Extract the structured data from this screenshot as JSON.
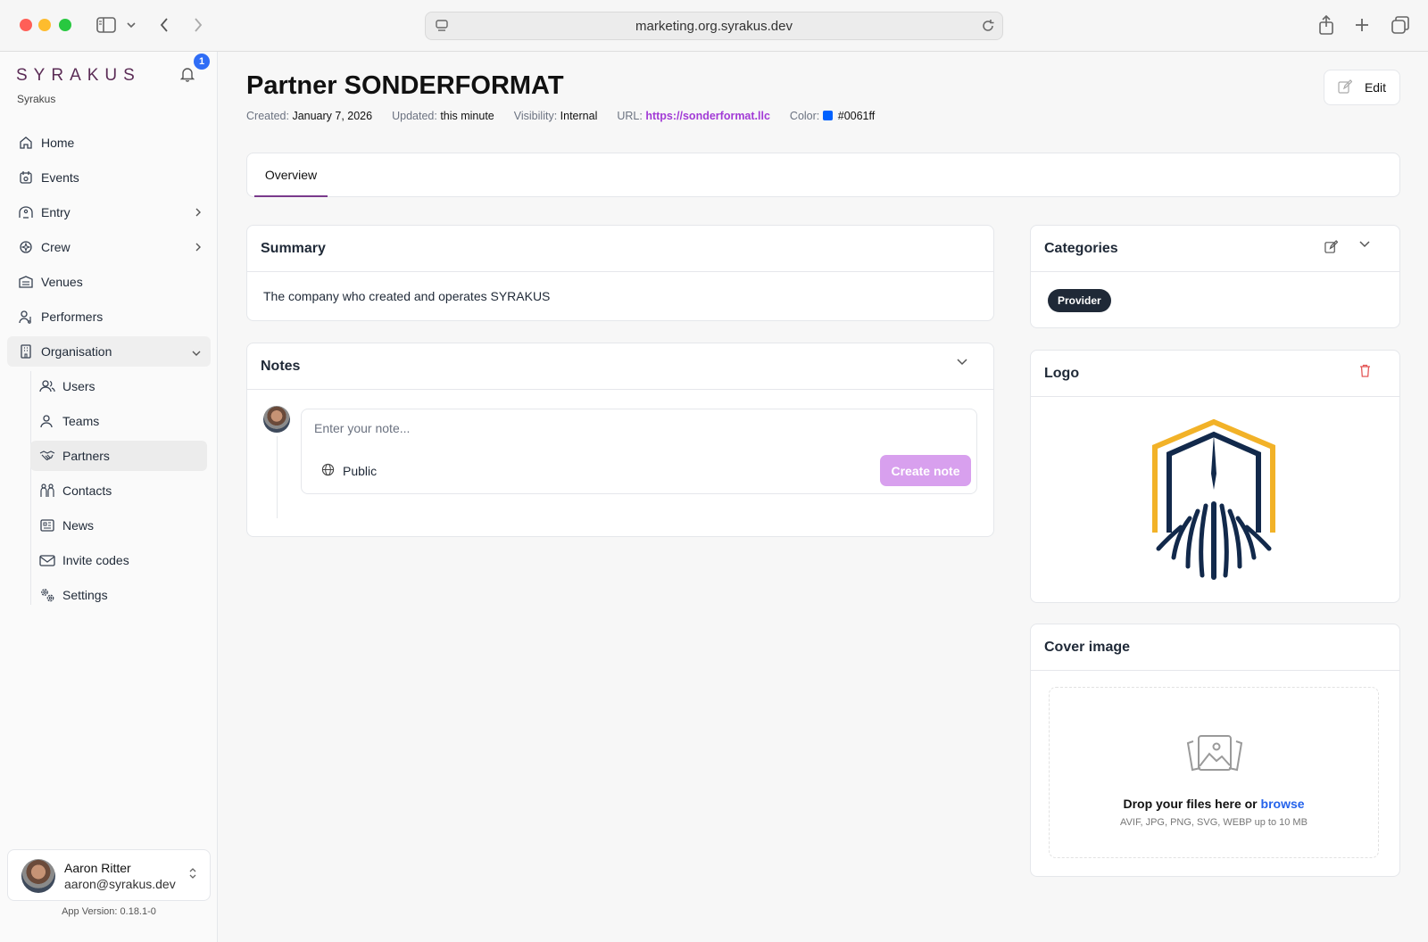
{
  "browser": {
    "url": "marketing.org.syrakus.dev"
  },
  "sidebar": {
    "brand": "SYRAKUS",
    "org_name": "Syrakus",
    "notification_count": "1",
    "items": [
      {
        "label": "Home",
        "icon": "home-icon"
      },
      {
        "label": "Events",
        "icon": "calendar-icon"
      },
      {
        "label": "Entry",
        "icon": "entry-icon"
      },
      {
        "label": "Crew",
        "icon": "crew-icon"
      },
      {
        "label": "Venues",
        "icon": "venue-icon"
      },
      {
        "label": "Performers",
        "icon": "performer-icon"
      },
      {
        "label": "Organisation",
        "icon": "building-icon"
      }
    ],
    "sub_items": [
      {
        "label": "Users",
        "icon": "users-icon"
      },
      {
        "label": "Teams",
        "icon": "teams-icon"
      },
      {
        "label": "Partners",
        "icon": "handshake-icon"
      },
      {
        "label": "Contacts",
        "icon": "contacts-icon"
      },
      {
        "label": "News",
        "icon": "news-icon"
      },
      {
        "label": "Invite codes",
        "icon": "envelope-icon"
      },
      {
        "label": "Settings",
        "icon": "gear-icon"
      }
    ],
    "user": {
      "name": "Aaron Ritter",
      "email": "aaron@syrakus.dev"
    },
    "app_version": "App Version: 0.18.1-0"
  },
  "page": {
    "title": "Partner SONDERFORMAT",
    "meta": {
      "created_label": "Created:",
      "created_value": "January 7, 2026",
      "updated_label": "Updated:",
      "updated_value": "this minute",
      "visibility_label": "Visibility:",
      "visibility_value": "Internal",
      "url_label": "URL:",
      "url_value": "https://sonderformat.llc",
      "color_label": "Color:",
      "color_value": "#0061ff"
    },
    "edit_label": "Edit",
    "tabs": [
      {
        "label": "Overview"
      }
    ]
  },
  "summary": {
    "title": "Summary",
    "text": "The company who created and operates SYRAKUS"
  },
  "notes": {
    "title": "Notes",
    "placeholder": "Enter your note...",
    "visibility": "Public",
    "create_label": "Create note"
  },
  "categories": {
    "title": "Categories",
    "chips": [
      "Provider"
    ]
  },
  "logo": {
    "title": "Logo"
  },
  "cover": {
    "title": "Cover image",
    "drop_text": "Drop your files here or",
    "browse": "browse",
    "hint": "AVIF, JPG, PNG, SVG, WEBP up to 10 MB"
  },
  "colors": {
    "accent": "#7a3a8c",
    "link": "#a23bd6",
    "partner_color": "#0061ff",
    "create_note_bg": "#d8a0ee",
    "logo_gold": "#f2b228",
    "logo_navy": "#12294b"
  }
}
